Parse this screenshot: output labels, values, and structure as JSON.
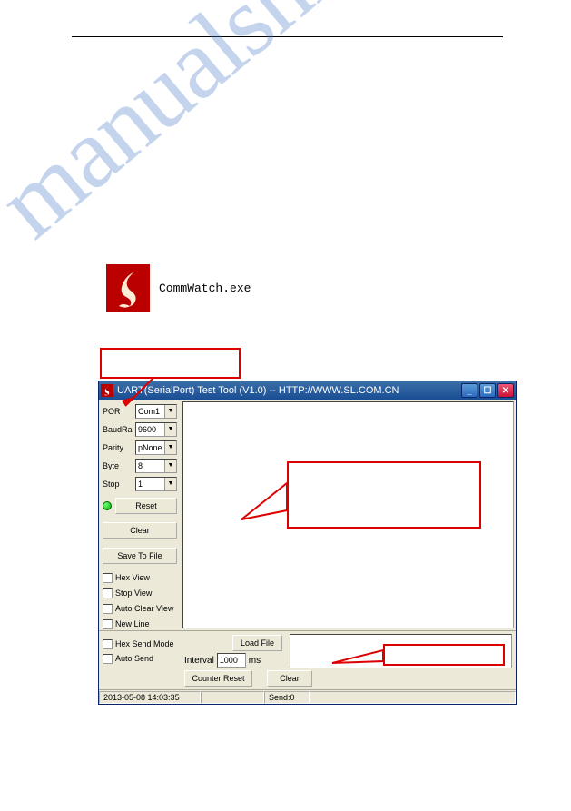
{
  "commwatch": {
    "label": "CommWatch.exe"
  },
  "window": {
    "title": "UART(SerialPort) Test Tool (V1.0) -- HTTP://WWW.SL.COM.CN",
    "port": {
      "label": "POR",
      "value": "Com1"
    },
    "baud": {
      "label": "BaudRa",
      "value": "9600"
    },
    "parity": {
      "label": "Parity",
      "value": "pNone"
    },
    "byte": {
      "label": "Byte",
      "value": "8"
    },
    "stop": {
      "label": "Stop",
      "value": "1"
    },
    "reset": "Reset",
    "clear": "Clear",
    "save_to_file": "Save To File",
    "hex_view": "Hex View",
    "stop_view": "Stop View",
    "auto_clear_view": "Auto Clear View",
    "new_line": "New Line",
    "hex_send_mode": "Hex Send Mode",
    "auto_send": "Auto Send",
    "interval_label": "Interval",
    "interval_value": "1000",
    "interval_unit": "ms",
    "load_file": "Load File",
    "counter_reset": "Counter Reset",
    "clear2": "Clear",
    "status_time": "2013-05-08 14:03:35",
    "status_send": "Send:0"
  }
}
